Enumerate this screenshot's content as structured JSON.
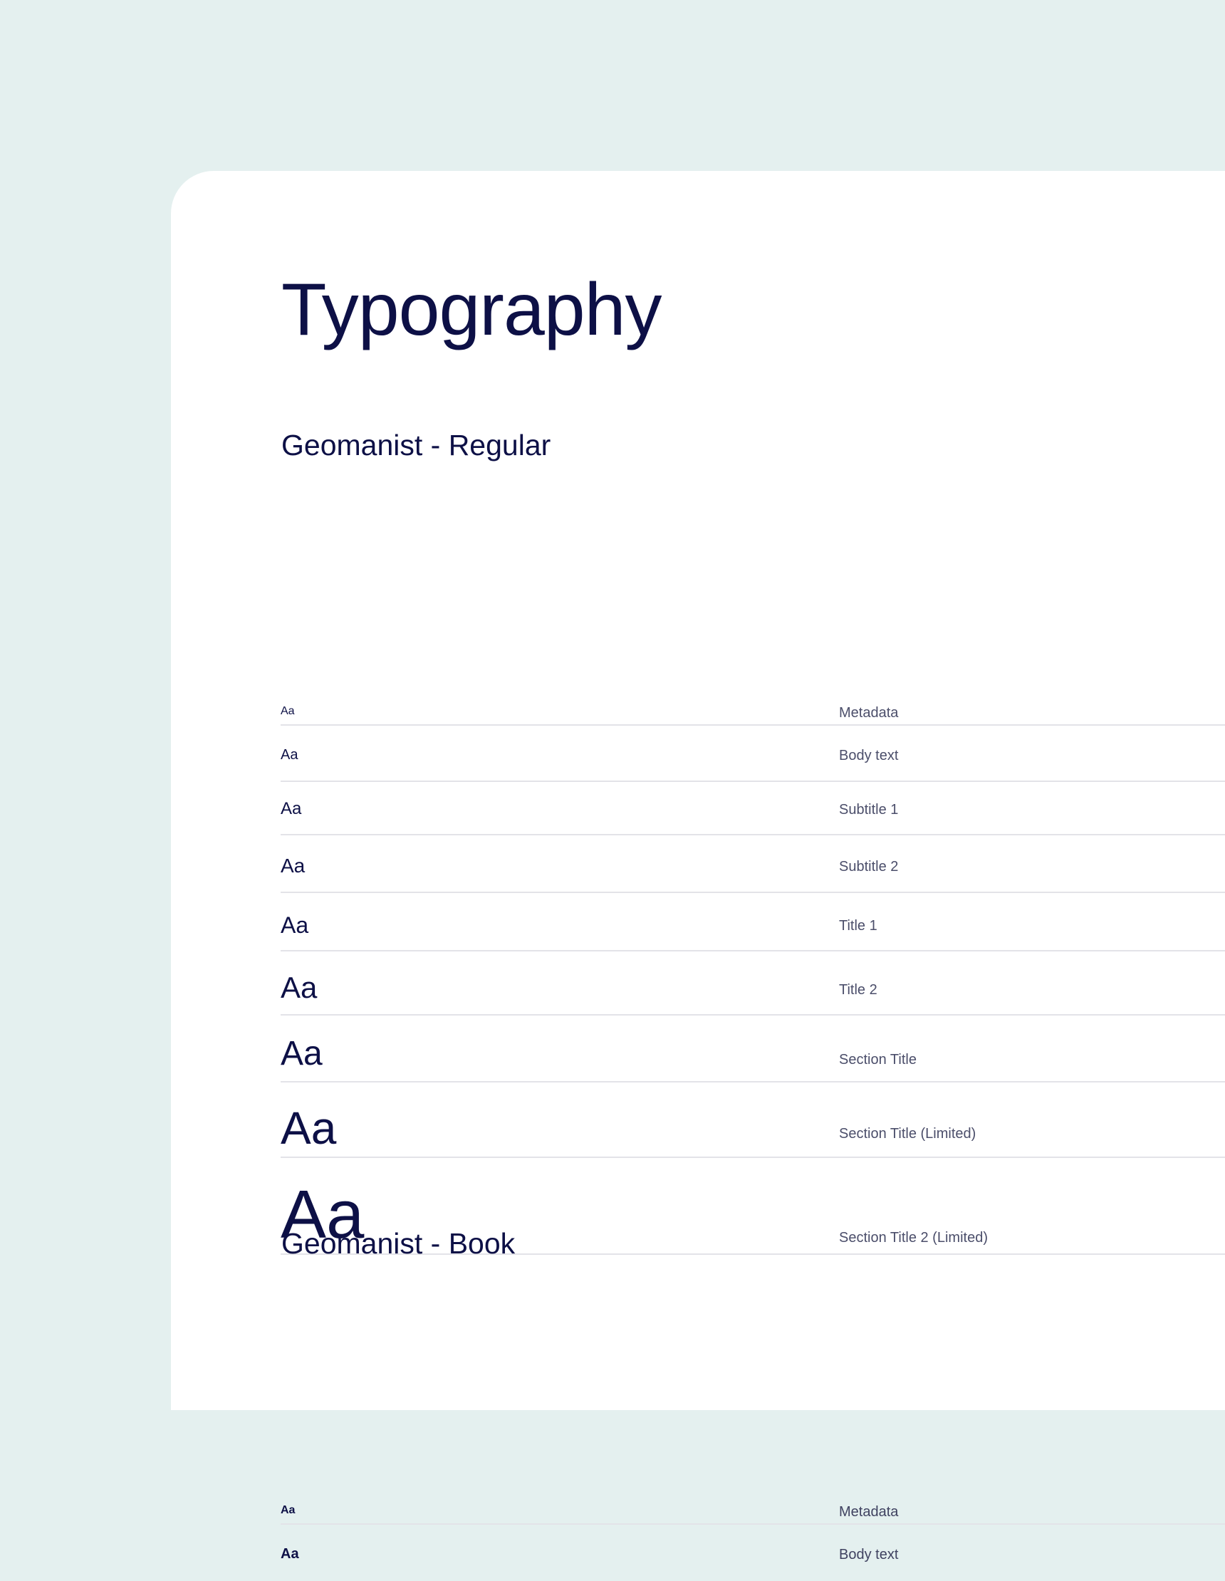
{
  "page": {
    "title": "Typography",
    "colors": {
      "background": "#e4f0ef",
      "card": "#ffffff",
      "ink": "#0d1046",
      "label": "#4b4e6a",
      "divider": "#e3e3e8"
    }
  },
  "sections": [
    {
      "title": "Geomanist - Regular",
      "rows": [
        {
          "sample": "Aa",
          "label": "Metadata"
        },
        {
          "sample": "Aa",
          "label": "Body text"
        },
        {
          "sample": "Aa",
          "label": "Subtitle 1"
        },
        {
          "sample": "Aa",
          "label": "Subtitle 2"
        },
        {
          "sample": "Aa",
          "label": "Title 1"
        },
        {
          "sample": "Aa",
          "label": "Title 2"
        },
        {
          "sample": "Aa",
          "label": "Section Title"
        },
        {
          "sample": "Aa",
          "label": "Section Title (Limited)"
        },
        {
          "sample": "Aa",
          "label": "Section Title 2 (Limited)"
        }
      ]
    },
    {
      "title": "Geomanist - Book",
      "rows": [
        {
          "sample": "Aa",
          "label": "Metadata"
        },
        {
          "sample": "Aa",
          "label": "Body text"
        }
      ]
    }
  ]
}
